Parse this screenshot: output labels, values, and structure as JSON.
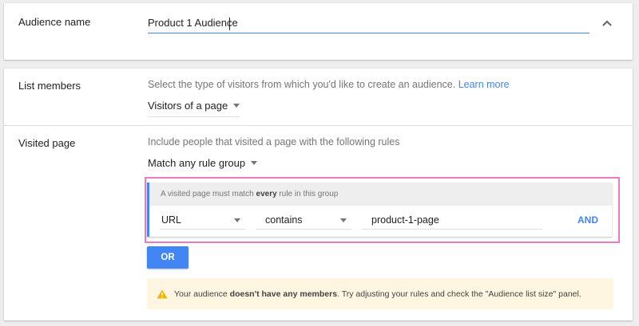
{
  "audience_name": {
    "label": "Audience name",
    "value": "Product 1 Audience"
  },
  "list_members": {
    "label": "List members",
    "help_text": "Select the type of visitors from which you'd like to create an audience. ",
    "learn_more": "Learn more",
    "selected": "Visitors of a page"
  },
  "visited_page": {
    "label": "Visited page",
    "help_text": "Include people that visited a page with the following rules",
    "match_selected": "Match any rule group",
    "rule_group": {
      "header_prefix": "A visited page must match ",
      "header_bold": "every",
      "header_suffix": " rule in this group",
      "rule": {
        "field": "URL",
        "operator": "contains",
        "value": "product-1-page"
      },
      "and_label": "AND"
    },
    "or_label": "OR"
  },
  "warning": {
    "prefix": "Your audience ",
    "bold": "doesn't have any members",
    "suffix": ". Try adjusting your rules and check the \"Audience list size\" panel."
  },
  "colors": {
    "accent": "#4285f4",
    "highlight": "#ec79c3",
    "warning_bg": "#fef6e0",
    "warning_icon": "#f4b400"
  },
  "icons": {
    "collapse": "chevron-up-icon",
    "dropdown": "caret-down-icon",
    "warning": "warning-triangle-icon"
  }
}
